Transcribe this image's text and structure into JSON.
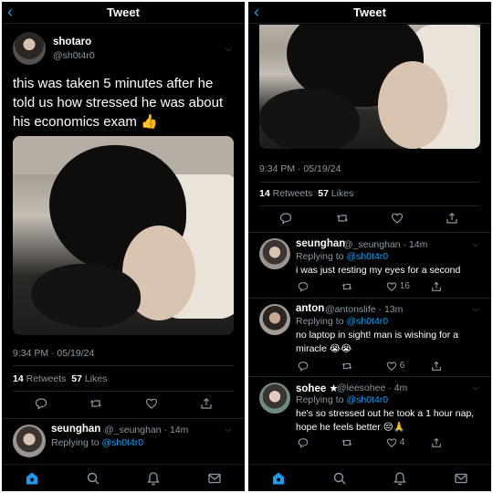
{
  "header": {
    "back_glyph": "‹",
    "title": "Tweet"
  },
  "tweet": {
    "author_name": "shotaro",
    "author_handle": "@sh0t4r0",
    "text": "this was taken 5 minutes after he told us how stressed he was about his economics exam 👍",
    "image_icon": "sleeping-photo",
    "time": "9:34 PM · 05/19/24",
    "retweets_count": "14",
    "retweets_label": "Retweets",
    "likes_count": "57",
    "likes_label": "Likes"
  },
  "icons": {
    "reply": "reply-icon",
    "retweet": "retweet-icon",
    "like": "heart-icon",
    "share": "share-icon",
    "more": "chevron-down-icon"
  },
  "replies": [
    {
      "name": "seunghan",
      "handle": "@_seunghan · 14m",
      "replying_label": "Replying to",
      "mention": "@sh0t4r0",
      "text": "i was just resting my eyes for a second",
      "likes": "16"
    },
    {
      "name": "anton",
      "handle": "@antonslife · 13m",
      "replying_label": "Replying to",
      "mention": "@sh0t4r0",
      "text": "no laptop in sight! man is wishing for a miracle 😭😭",
      "likes": "6"
    },
    {
      "name": "sohee ★",
      "handle": "@leesohee · 4m",
      "replying_label": "Replying to",
      "mention": "@sh0t4r0",
      "text": "he's so stressed out he took a 1 hour nap, hope he feels better 😔🙏",
      "likes": "4"
    }
  ],
  "tabbar": {
    "home_glyph": "⌂",
    "search_glyph": "⌕",
    "notifications_glyph": "🔔︎",
    "messages_glyph": "✉"
  },
  "colors": {
    "accent": "#1d9bf0",
    "background": "#000000",
    "muted": "#8b98a5"
  }
}
